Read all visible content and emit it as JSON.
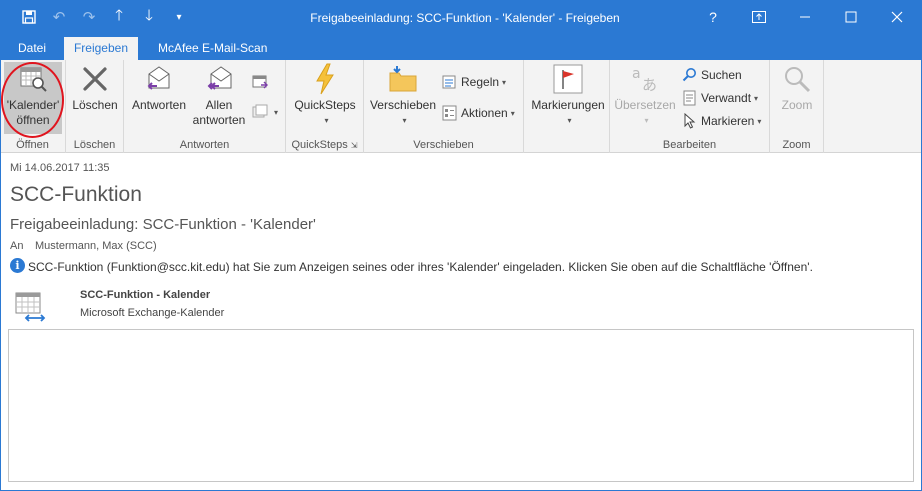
{
  "window": {
    "title": "Freigabeeinladung: SCC-Funktion - 'Kalender' - Freigeben",
    "help": "?"
  },
  "tabs": [
    {
      "label": "Datei"
    },
    {
      "label": "Freigeben",
      "active": true
    },
    {
      "label": "McAfee E-Mail-Scan"
    }
  ],
  "ribbon": {
    "open_group": {
      "button_line1": "'Kalender'",
      "button_line2": "öffnen",
      "label": "Öffnen"
    },
    "delete_group": {
      "button": "Löschen",
      "label": "Löschen"
    },
    "reply_group": {
      "reply": "Antworten",
      "reply_all_line1": "Allen",
      "reply_all_line2": "antworten",
      "label": "Antworten"
    },
    "quicksteps_group": {
      "button": "QuickSteps",
      "label": "QuickSteps"
    },
    "move_group": {
      "move": "Verschieben",
      "rules": "Regeln",
      "actions": "Aktionen",
      "label": "Verschieben"
    },
    "tags_group": {
      "button": "Markierungen"
    },
    "edit_group": {
      "translate": "Übersetzen",
      "search": "Suchen",
      "related": "Verwandt",
      "select": "Markieren",
      "label": "Bearbeiten"
    },
    "zoom_group": {
      "button": "Zoom",
      "label": "Zoom"
    }
  },
  "message": {
    "date": "Mi 14.06.2017 11:35",
    "sender": "SCC-Funktion",
    "subject": "Freigabeeinladung: SCC-Funktion - 'Kalender'",
    "to_label": "An",
    "to_value": "Mustermann, Max (SCC)",
    "info": "SCC-Funktion (Funktion@scc.kit.edu) hat Sie zum Anzeigen seines oder ihres 'Kalender' eingeladen.  Klicken Sie oben auf die Schaltfläche 'Öffnen'.",
    "calendar_name": "SCC-Funktion - Kalender",
    "calendar_type": "Microsoft Exchange-Kalender"
  },
  "colors": {
    "accent": "#2b79d3",
    "highlight": "#e0141e"
  },
  "icons": [
    "save-icon",
    "undo-icon",
    "redo-icon",
    "up-arrow-icon",
    "down-arrow-icon",
    "customize-qat-icon",
    "ribbon-display-icon",
    "minimize-icon",
    "maximize-icon",
    "close-icon",
    "calendar-search-icon",
    "delete-x-icon",
    "reply-icon",
    "reply-all-icon",
    "quicksteps-lightning-icon",
    "move-folder-icon",
    "rules-icon",
    "actions-icon",
    "flag-icon",
    "translate-icon",
    "search-icon",
    "related-icon",
    "select-cursor-icon",
    "zoom-icon",
    "info-icon",
    "shared-calendar-icon"
  ]
}
